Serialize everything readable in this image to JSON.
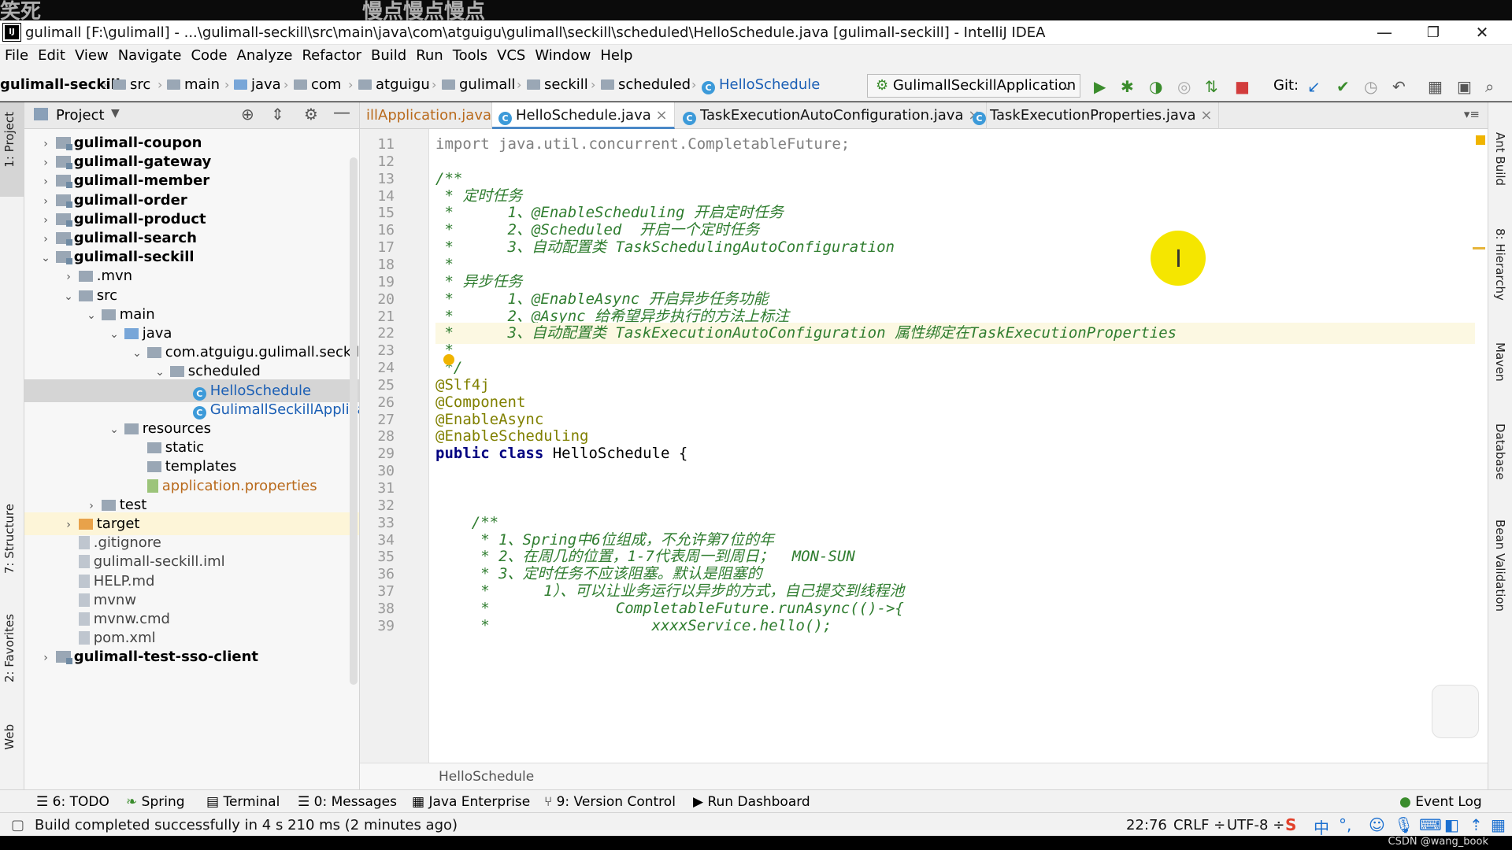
{
  "overlay": {
    "left_text": "笑死",
    "center_text": "慢点慢点慢点"
  },
  "window": {
    "title": "gulimall [F:\\gulimall] - ...\\gulimall-seckill\\src\\main\\java\\com\\atguigu\\gulimall\\seckill\\scheduled\\HelloSchedule.java [gulimall-seckill] - IntelliJ IDEA",
    "app_icon": "IJ",
    "minimize": "—",
    "restore": "❐",
    "close": "✕"
  },
  "menu": [
    "File",
    "Edit",
    "View",
    "Navigate",
    "Code",
    "Analyze",
    "Refactor",
    "Build",
    "Run",
    "Tools",
    "VCS",
    "Window",
    "Help"
  ],
  "nav": {
    "crumbs": [
      "gulimall-seckill",
      "src",
      "main",
      "java",
      "com",
      "atguigu",
      "gulimall",
      "seckill",
      "scheduled",
      "HelloSchedule"
    ],
    "run_config": "GulimallSeckillApplication",
    "git_label": "Git:"
  },
  "left_tabs": {
    "project": "1: Project",
    "structure": "7: Structure",
    "favorites": "2: Favorites",
    "web": "Web"
  },
  "project": {
    "header": "Project",
    "tree": [
      {
        "label": "gulimall-coupon",
        "indent": 0,
        "type": "module",
        "arrow": "›"
      },
      {
        "label": "gulimall-gateway",
        "indent": 0,
        "type": "module",
        "arrow": "›"
      },
      {
        "label": "gulimall-member",
        "indent": 0,
        "type": "module",
        "arrow": "›"
      },
      {
        "label": "gulimall-order",
        "indent": 0,
        "type": "module",
        "arrow": "›"
      },
      {
        "label": "gulimall-product",
        "indent": 0,
        "type": "module",
        "arrow": "›"
      },
      {
        "label": "gulimall-search",
        "indent": 0,
        "type": "module",
        "arrow": "›"
      },
      {
        "label": "gulimall-seckill",
        "indent": 0,
        "type": "module",
        "arrow": "⌄"
      },
      {
        "label": ".mvn",
        "indent": 1,
        "type": "folder",
        "arrow": "›"
      },
      {
        "label": "src",
        "indent": 1,
        "type": "folder",
        "arrow": "⌄"
      },
      {
        "label": "main",
        "indent": 2,
        "type": "folder",
        "arrow": "⌄"
      },
      {
        "label": "java",
        "indent": 3,
        "type": "srcfolder",
        "arrow": "⌄"
      },
      {
        "label": "com.atguigu.gulimall.seckill",
        "indent": 4,
        "type": "folder",
        "arrow": "⌄"
      },
      {
        "label": "scheduled",
        "indent": 5,
        "type": "folder",
        "arrow": "⌄"
      },
      {
        "label": "HelloSchedule",
        "indent": 6,
        "type": "class",
        "arrow": ""
      },
      {
        "label": "GulimallSeckillApplication",
        "indent": 6,
        "type": "class",
        "arrow": ""
      },
      {
        "label": "resources",
        "indent": 3,
        "type": "folder",
        "arrow": "⌄"
      },
      {
        "label": "static",
        "indent": 4,
        "type": "folder",
        "arrow": ""
      },
      {
        "label": "templates",
        "indent": 4,
        "type": "folder",
        "arrow": ""
      },
      {
        "label": "application.properties",
        "indent": 4,
        "type": "props",
        "arrow": ""
      },
      {
        "label": "test",
        "indent": 2,
        "type": "folder",
        "arrow": "›"
      },
      {
        "label": "target",
        "indent": 1,
        "type": "target",
        "arrow": "›"
      },
      {
        "label": ".gitignore",
        "indent": 1,
        "type": "file",
        "arrow": ""
      },
      {
        "label": "gulimall-seckill.iml",
        "indent": 1,
        "type": "file",
        "arrow": ""
      },
      {
        "label": "HELP.md",
        "indent": 1,
        "type": "file",
        "arrow": ""
      },
      {
        "label": "mvnw",
        "indent": 1,
        "type": "file",
        "arrow": ""
      },
      {
        "label": "mvnw.cmd",
        "indent": 1,
        "type": "file",
        "arrow": ""
      },
      {
        "label": "pom.xml",
        "indent": 1,
        "type": "pom",
        "arrow": ""
      },
      {
        "label": "gulimall-test-sso-client",
        "indent": 0,
        "type": "module",
        "arrow": "›"
      }
    ]
  },
  "editor": {
    "tabs": [
      "illApplication.java",
      "HelloSchedule.java",
      "TaskExecutionAutoConfiguration.java",
      "TaskExecutionProperties.java"
    ],
    "tab_close": "×",
    "line_numbers": [
      "11",
      "12",
      "13",
      "14",
      "15",
      "16",
      "17",
      "18",
      "19",
      "20",
      "21",
      "22",
      "23",
      "24",
      "25",
      "26",
      "27",
      "28",
      "29",
      "30",
      "31",
      "32",
      "33",
      "34",
      "35",
      "36",
      "37",
      "38",
      "39"
    ],
    "lines": [
      "import java.util.concurrent.CompletableFuture;",
      "",
      "/**",
      " * 定时任务",
      " *      1、@EnableScheduling 开启定时任务",
      " *      2、@Scheduled  开启一个定时任务",
      " *      3、自动配置类 TaskSchedulingAutoConfiguration",
      " *",
      " * 异步任务",
      " *      1、@EnableAsync 开启异步任务功能",
      " *      2、@Async 给希望异步执行的方法上标注",
      " *      3、自动配置类 TaskExecutionAutoConfiguration 属性绑定在TaskExecutionProperties",
      " *",
      " */",
      "@Slf4j",
      "@Component",
      "@EnableAsync",
      "@EnableScheduling",
      "public class HelloSchedule {",
      "",
      "",
      "",
      "    /**",
      "     * 1、Spring中6位组成，不允许第7位的年",
      "     * 2、在周几的位置，1-7代表周一到周日；  MON-SUN",
      "     * 3、定时任务不应该阻塞。默认是阻塞的",
      "     *      1）、可以让业务运行以异步的方式，自己提交到线程池",
      "     *              CompletableFuture.runAsync(()->{",
      "     *                  xxxxService.hello();"
    ],
    "breadcrumb": "HelloSchedule"
  },
  "right_tabs": {
    "ant": "Ant Build",
    "hierarchy": "8: Hierarchy",
    "maven": "Maven",
    "database": "Database",
    "bean": "Bean Validation"
  },
  "bottom_tabs": {
    "todo": "6: TODO",
    "spring": "Spring",
    "terminal": "Terminal",
    "messages": "0: Messages",
    "java_enterprise": "Java Enterprise",
    "version_control": "9: Version Control",
    "run_dashboard": "Run Dashboard",
    "event_log": "Event Log"
  },
  "status": {
    "message": "Build completed successfully in 4 s 210 ms (2 minutes ago)",
    "position": "22:76",
    "line_sep": "CRLF ÷",
    "encoding": "UTF-8 ÷",
    "ime": "中",
    "watermark": "CSDN @wang_book"
  }
}
